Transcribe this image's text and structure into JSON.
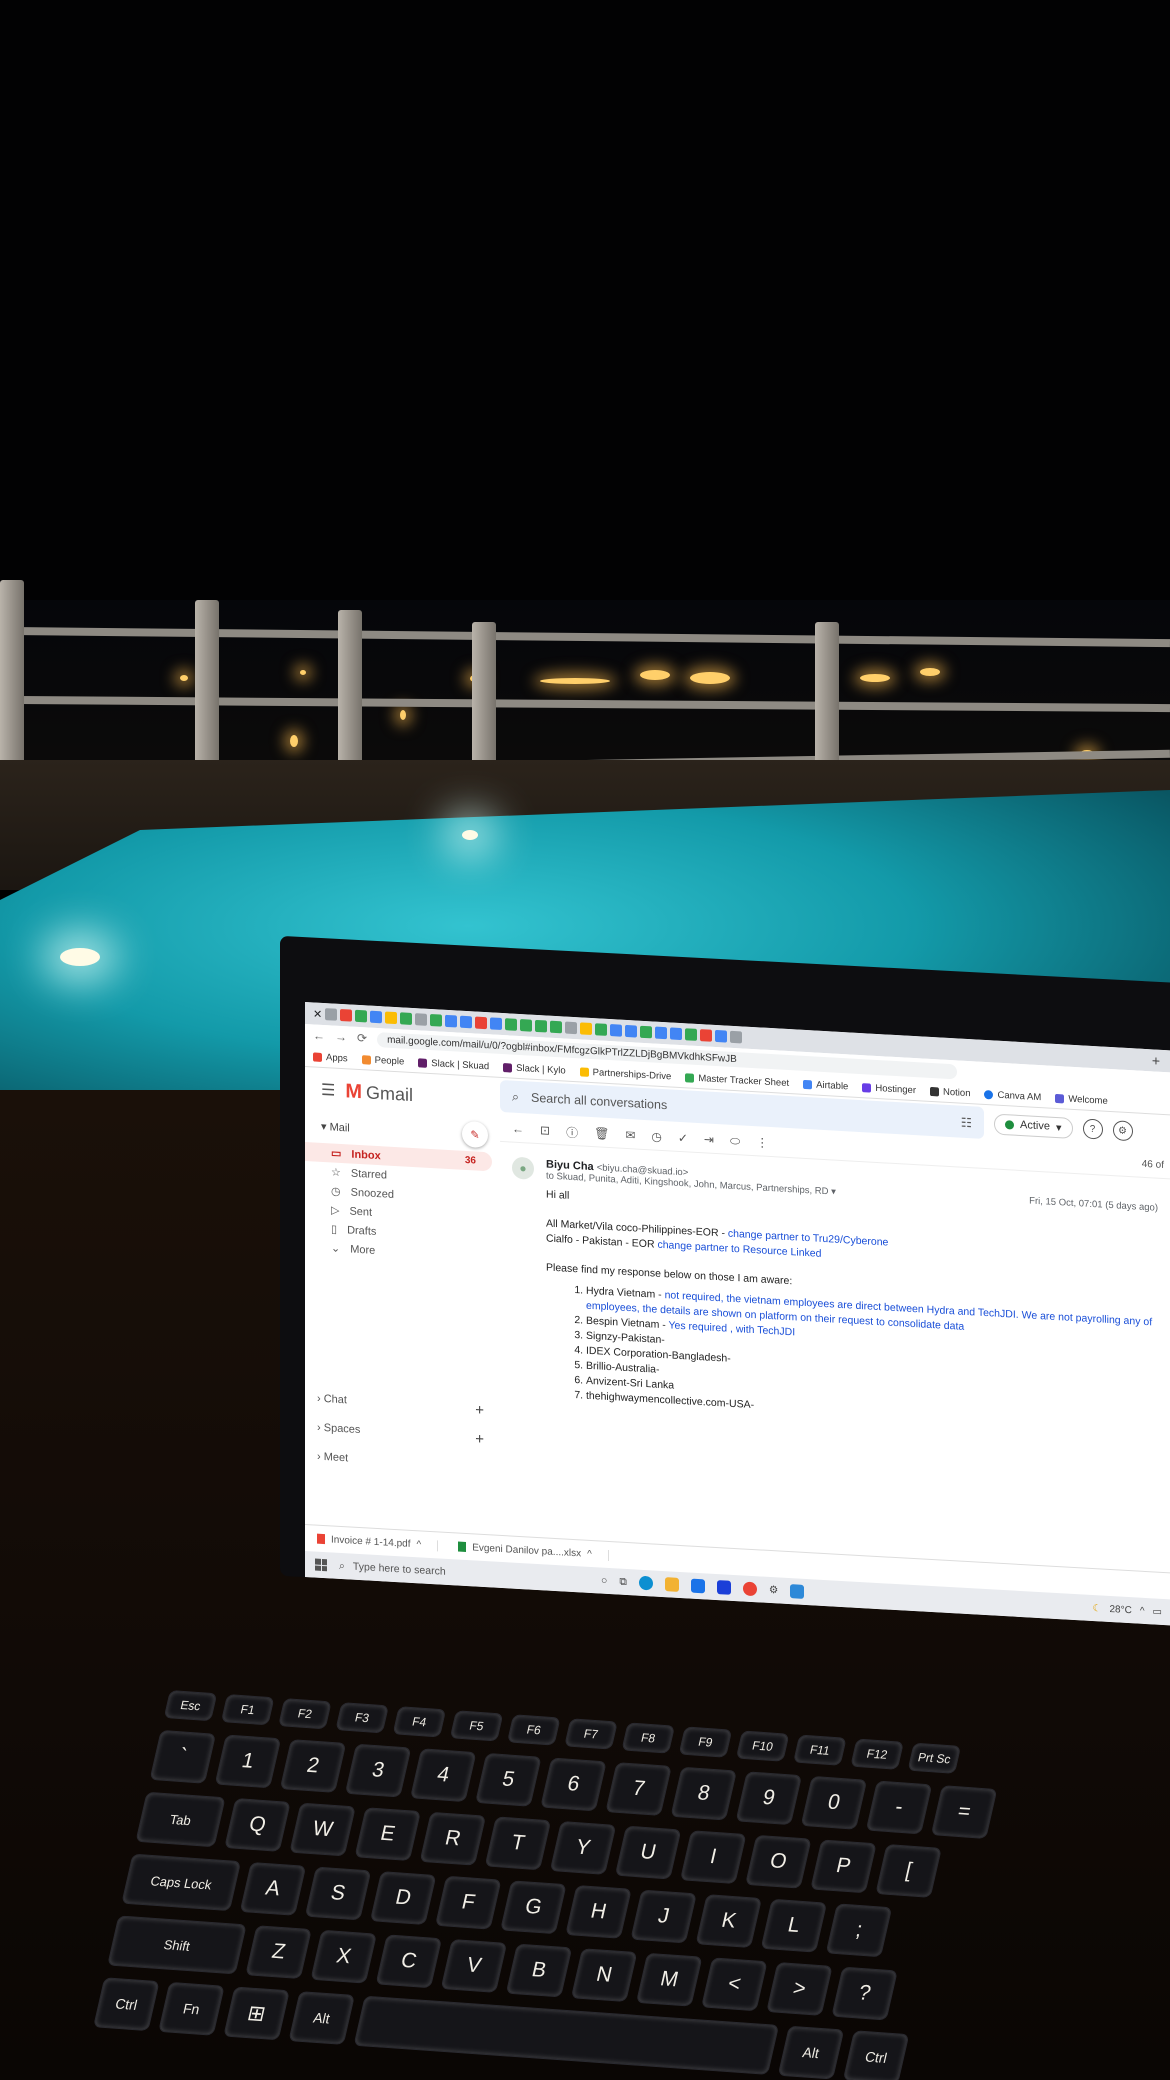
{
  "browser": {
    "url": "mail.google.com/mail/u/0/?ogbl#inbox/FMfcgzGlkPTrlZZLDjBgBMVkdhkSFwJB",
    "bookmarks": [
      "Apps",
      "People",
      "Slack | Skuad",
      "Slack | Kylo",
      "Partnerships-Drive",
      "Master Tracker Sheet",
      "Airtable",
      "Hostinger",
      "Notion",
      "Canva AM",
      "Welcome"
    ]
  },
  "gmail": {
    "logo": "Gmail",
    "mail_header": "Mail",
    "nav": [
      {
        "label": "Inbox",
        "count": "36"
      },
      {
        "label": "Starred"
      },
      {
        "label": "Snoozed"
      },
      {
        "label": "Sent"
      },
      {
        "label": "Drafts"
      },
      {
        "label": "More"
      }
    ],
    "sections": [
      "Chat",
      "Spaces",
      "Meet"
    ],
    "search_placeholder": "Search all conversations",
    "status": "Active",
    "page_count": "46 of",
    "message": {
      "sender": "Biyu Cha",
      "email": "<biyu.cha@skuad.io>",
      "to": "to Skuad, Punita, Aditi, Kingshook, John, Marcus, Partnerships, RD",
      "date": "Fri, 15 Oct, 07:01 (5 days ago)",
      "greeting": "Hi all",
      "line1_prefix": "All Market/Vila coco-Philippines-EOR -",
      "line1_link": "change partner to Tru29/Cyberone",
      "line2_prefix": "Cialfo - Pakistan - EOR",
      "line2_link": "change partner to Resource Linked",
      "intro": "Please find my response below on those I am aware:",
      "items": [
        {
          "prefix": "Hydra Vietnam -",
          "note": "not required, the vietnam employees are direct between Hydra and TechJDI. We are not payrolling any of employees, the details are shown on platform on their request to consolidate data"
        },
        {
          "prefix": "Bespin Vietnam -",
          "note": "Yes required , with TechJDI"
        },
        {
          "prefix": "Signzy-Pakistan-",
          "note": ""
        },
        {
          "prefix": "IDEX Corporation-Bangladesh-",
          "note": ""
        },
        {
          "prefix": "Brillio-Australia-",
          "note": ""
        },
        {
          "prefix": "Anvizent-Sri Lanka",
          "note": ""
        },
        {
          "prefix": "thehighwaymencollective.com-USA-",
          "note": ""
        }
      ]
    },
    "downloads": [
      "Invoice # 1-14.pdf",
      "Evgeni Danilov pa....xlsx"
    ]
  },
  "taskbar": {
    "search_placeholder": "Type here to search",
    "temperature": "28°C"
  },
  "keyboard": {
    "fn_row": [
      "Esc",
      "F1",
      "F2",
      "F3",
      "F4",
      "F5",
      "F6",
      "F7",
      "F8",
      "F9",
      "F10",
      "F11",
      "F12",
      "Prt Sc"
    ],
    "num_row": [
      "`",
      "1",
      "2",
      "3",
      "4",
      "5",
      "6",
      "7",
      "8",
      "9",
      "0",
      "-",
      "="
    ],
    "row_q": [
      "Tab",
      "Q",
      "W",
      "E",
      "R",
      "T",
      "Y",
      "U",
      "I",
      "O",
      "P",
      "["
    ],
    "row_a": [
      "Caps Lock",
      "A",
      "S",
      "D",
      "F",
      "G",
      "H",
      "J",
      "K",
      "L",
      ";"
    ],
    "row_z": [
      "Shift",
      "Z",
      "X",
      "C",
      "V",
      "B",
      "N",
      "M",
      "<",
      ">",
      "?"
    ],
    "row_ctrl": [
      "Ctrl",
      "Fn",
      "⊞",
      "Alt",
      "Alt",
      "Ctrl"
    ]
  }
}
